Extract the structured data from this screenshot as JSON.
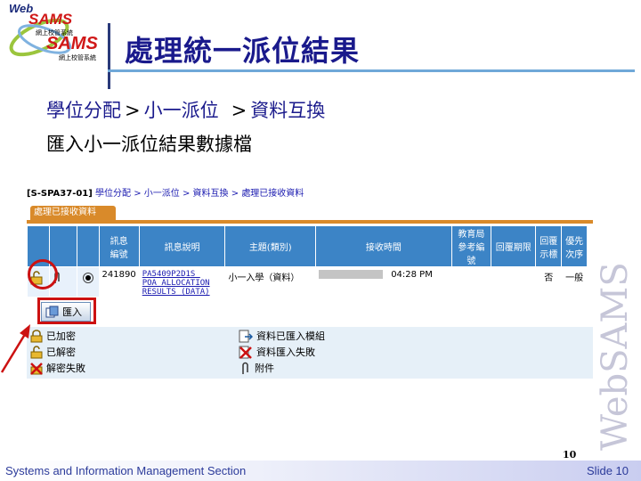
{
  "logo": {
    "line1": "Web",
    "line2": "SAMS",
    "line3": "SAMS",
    "tagline_top": "網上校管系統",
    "tagline_bottom": "網上校管系統"
  },
  "title": "處理統一派位結果",
  "breadcrumb": {
    "level1": "學位分配",
    "level2": "小一派位",
    "level3": "資料互換",
    "separator": ">"
  },
  "subheading": "匯入小一派位結果數據檔",
  "screen": {
    "path": {
      "code": "[S-SPA37-01]",
      "items": [
        "學位分配",
        "小一派位",
        "資料互換",
        "處理已接收資料"
      ],
      "separator": ">"
    },
    "tab_label": "處理已接收資料",
    "columns": [
      "訊息\n編號",
      "訊息說明",
      "主題(類別)",
      "接收時間",
      "教育局\n參考編號",
      "回覆期限",
      "回覆\n示標",
      "優先\n次序"
    ],
    "row": {
      "msg_no": "241890",
      "description_lines": [
        "PA5409P2D1S_",
        "POA_ALLOCATION",
        "RESULTS_(DATA)"
      ],
      "subject": "小一入學（資料）",
      "time": "04:28 PM",
      "reply_flag": "否",
      "priority": "一般"
    },
    "import_button": "匯入",
    "legend": {
      "locked": "已加密",
      "unlocked": "已解密",
      "decrypt_failed": "解密失敗",
      "imported": "資料已匯入模組",
      "import_failed": "資料匯入失敗",
      "attachment": "附件"
    }
  },
  "watermark": "WebSAMS",
  "page_number": "10",
  "footer": {
    "left": "Systems and Information Management Section",
    "right": "Slide 10"
  },
  "colors": {
    "title": "#1a1a8c",
    "table_header": "#3c84c6",
    "tab": "#d98a2a",
    "highlight": "#cc1111"
  }
}
